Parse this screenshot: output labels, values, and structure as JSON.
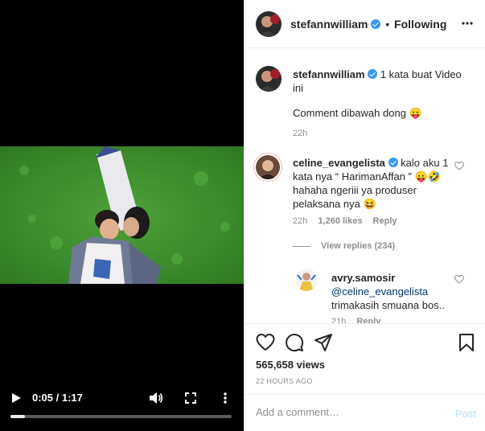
{
  "video": {
    "time_readout": "0:05 / 1:17",
    "progress": 0.065
  },
  "header": {
    "username": "stefannwilliam",
    "separator": "•",
    "follow_status": "Following"
  },
  "caption": {
    "username": "stefannwilliam",
    "line1": "1 kata buat Video",
    "line2": "ini",
    "line3": "Comment dibawah dong 😛",
    "time": "22h"
  },
  "comment": {
    "username": "celine_evangelista",
    "line1": "kalo aku 1",
    "line2": "kata nya “ HarimanAffan ” 😛🤣",
    "line3": "hahaha ngeriii ya produser",
    "line4": "pelaksana nya 😆",
    "time": "22h",
    "likes": "1,260 likes",
    "reply_label": "Reply",
    "view_replies": "View replies (234)"
  },
  "reply": {
    "username": "avry.samosir",
    "mention": "@celine_evangelista",
    "line2": "trimakasih smuana bos..",
    "time": "21h",
    "reply_label": "Reply"
  },
  "stats": {
    "views": "565,658 views",
    "time_ago": "22 HOURS AGO"
  },
  "composer": {
    "placeholder": "Add a comment…",
    "post_label": "Post"
  },
  "colors": {
    "link_blue": "#3897f0",
    "verified_blue": "#3897f0",
    "post_disabled": "#b2dffc",
    "secondary_text": "#8e8e8e",
    "video_bg": "#000000"
  },
  "icons": {
    "play": "play-icon",
    "volume": "volume-icon",
    "fullscreen": "fullscreen-icon",
    "video_more": "vertical-dots-icon",
    "header_more": "horizontal-dots-icon",
    "like": "heart-icon",
    "comment": "comment-bubble-icon",
    "share": "paper-plane-icon",
    "save": "bookmark-icon"
  }
}
